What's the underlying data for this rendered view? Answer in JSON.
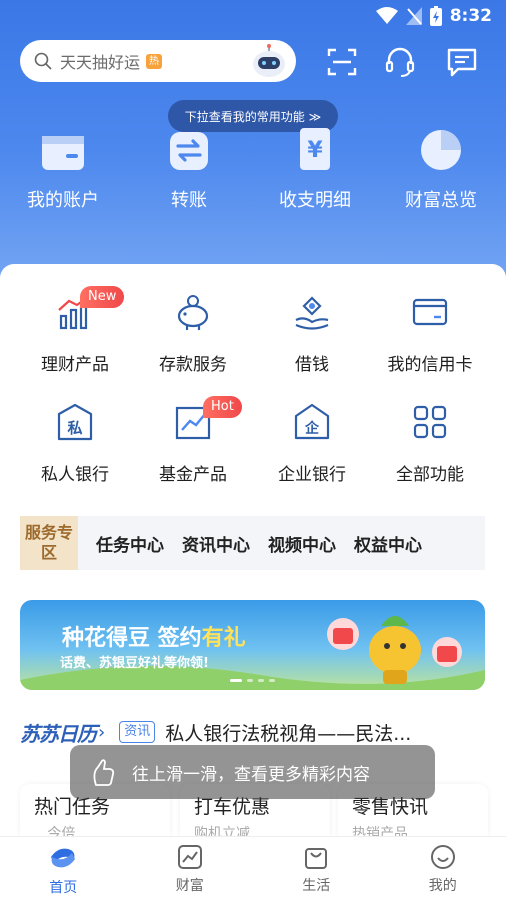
{
  "status": {
    "time": "8:32"
  },
  "search": {
    "placeholder": "天天抽好运",
    "hot_badge": "热"
  },
  "pull_tip": "下拉查看我的常用功能 ≫",
  "quick_actions": [
    {
      "label": "我的账户",
      "icon": "wallet-icon"
    },
    {
      "label": "转账",
      "icon": "transfer-icon"
    },
    {
      "label": "收支明细",
      "icon": "statement-icon"
    },
    {
      "label": "财富总览",
      "icon": "pie-chart-icon"
    }
  ],
  "services": [
    {
      "label": "理财产品",
      "icon": "growth-chart-icon",
      "badge": "New"
    },
    {
      "label": "存款服务",
      "icon": "piggy-bank-icon"
    },
    {
      "label": "借钱",
      "icon": "hand-coin-icon"
    },
    {
      "label": "我的信用卡",
      "icon": "credit-card-icon"
    },
    {
      "label": "私人银行",
      "icon": "private-bank-icon",
      "badge_text": "私"
    },
    {
      "label": "基金产品",
      "icon": "fund-chart-icon",
      "badge": "Hot"
    },
    {
      "label": "企业银行",
      "icon": "enterprise-icon",
      "badge_text": "企"
    },
    {
      "label": "全部功能",
      "icon": "grid-icon"
    }
  ],
  "service_zone": {
    "tag": "服务专区",
    "links": [
      "任务中心",
      "资讯中心",
      "视频中心",
      "权益中心"
    ]
  },
  "banner": {
    "title_a": "种花得豆 签约",
    "title_b": "有礼",
    "subtitle": "话费、苏银豆好礼等你领!"
  },
  "news": {
    "logo": "苏苏日历",
    "tag": "资讯",
    "text": "私人银行法税视角——民法..."
  },
  "toast": "往上滑一滑，查看更多精彩内容",
  "mini_cards": [
    {
      "title": "热门任务",
      "sub": "...今倍"
    },
    {
      "title": "打车优惠",
      "sub": "购机立减"
    },
    {
      "title": "零售快讯",
      "sub": "热销产品"
    }
  ],
  "nav": [
    {
      "label": "首页",
      "icon": "home-icon",
      "active": true
    },
    {
      "label": "财富",
      "icon": "wealth-icon"
    },
    {
      "label": "生活",
      "icon": "life-bag-icon"
    },
    {
      "label": "我的",
      "icon": "profile-icon"
    }
  ],
  "colors": {
    "primary": "#2f6ee2",
    "hero_top": "#3b78e6",
    "badge_red": "#f0484b",
    "gold": "#9c6a2c"
  }
}
